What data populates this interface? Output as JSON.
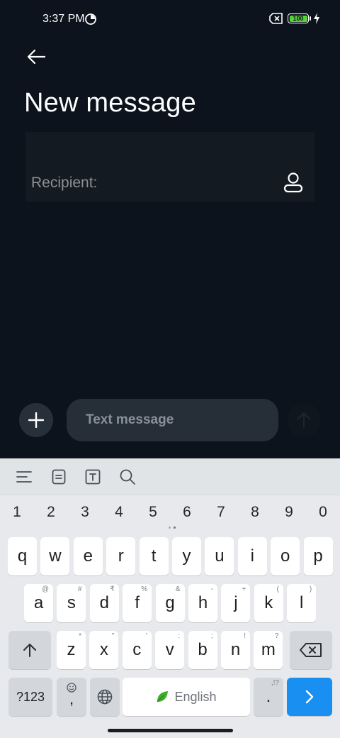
{
  "status_bar": {
    "time": "3:37 PM",
    "app_icon": "pie-chart-icon",
    "no_sim_icon": "no-sim-icon",
    "battery_level": "100",
    "charging_icon": "lightning-icon",
    "battery_color": "#5ad13a"
  },
  "header": {
    "back_icon": "arrow-left-icon",
    "title": "New message"
  },
  "recipient": {
    "placeholder": "Recipient:",
    "contact_icon": "person-icon"
  },
  "compose": {
    "add_icon": "plus-icon",
    "placeholder": "Text message",
    "send_icon": "arrow-up-icon"
  },
  "keyboard": {
    "toolbar": [
      "menu-lines-icon",
      "clipboard-icon",
      "text-box-icon",
      "search-icon"
    ],
    "numbers": [
      "1",
      "2",
      "3",
      "4",
      "5",
      "6",
      "7",
      "8",
      "9",
      "0"
    ],
    "row1": [
      {
        "key": "q",
        "hint": ""
      },
      {
        "key": "w",
        "hint": ""
      },
      {
        "key": "e",
        "hint": ""
      },
      {
        "key": "r",
        "hint": ""
      },
      {
        "key": "t",
        "hint": ""
      },
      {
        "key": "y",
        "hint": ""
      },
      {
        "key": "u",
        "hint": ""
      },
      {
        "key": "i",
        "hint": ""
      },
      {
        "key": "o",
        "hint": ""
      },
      {
        "key": "p",
        "hint": ""
      }
    ],
    "row2": [
      {
        "key": "a",
        "hint": "@"
      },
      {
        "key": "s",
        "hint": "#"
      },
      {
        "key": "d",
        "hint": "₹"
      },
      {
        "key": "f",
        "hint": "%"
      },
      {
        "key": "g",
        "hint": "&"
      },
      {
        "key": "h",
        "hint": "-"
      },
      {
        "key": "j",
        "hint": "+"
      },
      {
        "key": "k",
        "hint": "("
      },
      {
        "key": "l",
        "hint": ")"
      }
    ],
    "row3": [
      {
        "key": "z",
        "hint": "*"
      },
      {
        "key": "x",
        "hint": "\""
      },
      {
        "key": "c",
        "hint": "'"
      },
      {
        "key": "v",
        "hint": ":"
      },
      {
        "key": "b",
        "hint": ";"
      },
      {
        "key": "n",
        "hint": "!"
      },
      {
        "key": "m",
        "hint": "?"
      }
    ],
    "shift_icon": "shift-arrow-icon",
    "backspace_icon": "backspace-icon",
    "symbols_label": "?123",
    "comma_label": ",",
    "emoji_icon": "emoji-icon",
    "globe_icon": "globe-icon",
    "space_label": "English",
    "space_icon": "leaf-icon",
    "period_label": ".",
    "period_hint": ",!?",
    "enter_icon": "chevron-right-icon",
    "accent_color": "#1a8ff2"
  }
}
